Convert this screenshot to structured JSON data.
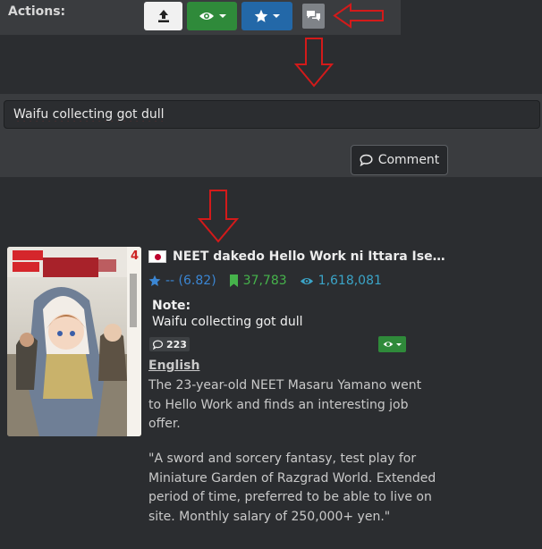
{
  "actions": {
    "label": "Actions:",
    "upload_icon": "upload-icon",
    "follow_icon": "eye-icon",
    "rate_icon": "star-icon",
    "comment_icon": "comments-icon"
  },
  "comment_box": {
    "value": "Waifu collecting got dull",
    "button_label": "Comment"
  },
  "manga": {
    "flag": "jp",
    "title": "NEET dakedo Hello Work ni Ittara Ise…",
    "rating": "-- (6.82)",
    "follows": "37,783",
    "views": "1,618,081",
    "note_label": "Note:",
    "note_text": "Waifu collecting got dull",
    "comments_count": "223",
    "language": "English",
    "description_1": [
      "The 23-year-old NEET Masaru Yamano went",
      "to Hello Work and finds an interesting job",
      "offer."
    ],
    "description_2": [
      "\"A sword and sorcery fantasy, test play for",
      "Miniature Garden of Razgrad World. Extended",
      "period of time, preferred to be able to live on",
      "site. Monthly salary of 250,000+ yen.\""
    ],
    "cover_number": "4"
  },
  "colors": {
    "follow_green": "#2f8a3a",
    "rate_blue": "#2368a8",
    "rating_color": "#3b86d3",
    "follows_color": "#46b34b",
    "views_color": "#3ba4c7",
    "arrow_red": "#d31a1a"
  }
}
